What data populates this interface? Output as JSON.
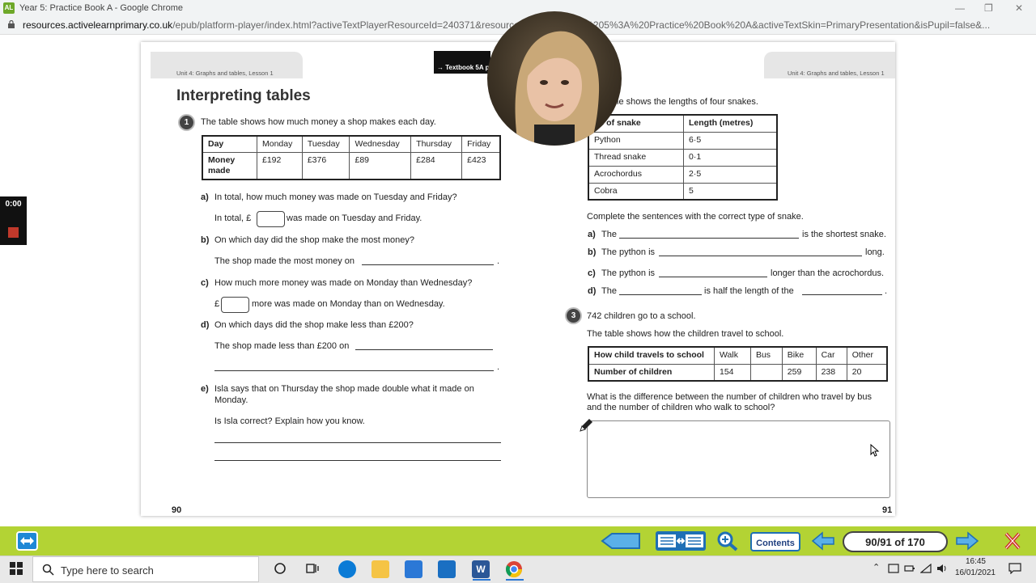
{
  "browser": {
    "window_title": "Year 5: Practice Book A - Google Chrome",
    "app_badge": "AL",
    "url_host": "resources.activelearnprimary.co.uk",
    "url_path": "/epub/platform-player/index.html?activeTextPlayerResourceId=240371&resourceId=...Title=Year%205%3A%20Practice%20Book%20A&activeTextSkin=PrimaryPresentation&isPupil=false&..."
  },
  "recorder": {
    "time": "0:00"
  },
  "left_page": {
    "unit_label": "Unit 4: Graphs and tables, Lesson 1",
    "title": "Interpreting tables",
    "q1": {
      "number": "1",
      "intro": "The table shows how much money a shop makes each day.",
      "table_header": [
        "Day",
        "Monday",
        "Tuesday",
        "Wednesday",
        "Thursday",
        "Friday"
      ],
      "row_label": "Money made",
      "row_values": [
        "£192",
        "£376",
        "£89",
        "£284",
        "£423"
      ],
      "a_label": "a)",
      "a_q": "In total, how much money was made on Tuesday and Friday?",
      "a_pre": "In total, £",
      "a_post": "was made on Tuesday and Friday.",
      "b_label": "b)",
      "b_q": "On which day did the shop make the most money?",
      "b_ans": "The shop made the most money on",
      "c_label": "c)",
      "c_q": "How much more money was made on Monday than Wednesday?",
      "c_pre": "£",
      "c_post": "more was made on Monday than on Wednesday.",
      "d_label": "d)",
      "d_q": "On which days did the shop make less than £200?",
      "d_ans": "The shop made less than £200 on",
      "e_label": "e)",
      "e_q1": "Isla says that on Thursday the shop made double what it made on",
      "e_q2": "Monday.",
      "e_sub": "Is Isla correct? Explain how you know."
    },
    "page_number": "90",
    "textbook_tab": "→ Textbook 5A p"
  },
  "right_page": {
    "unit_label": "Unit 4: Graphs and tables, Lesson 1",
    "q2": {
      "intro_visible": "le shows the lengths of four snakes.",
      "header": [
        "pe of snake",
        "Length (metres)"
      ],
      "rows": [
        [
          "Python",
          "6·5"
        ],
        [
          "Thread snake",
          "0·1"
        ],
        [
          "Acrochordus",
          "2·5"
        ],
        [
          "Cobra",
          "5"
        ]
      ],
      "instruction": "Complete the sentences with the correct type of snake.",
      "a_label": "a)",
      "a_pre": "The",
      "a_post": "is the shortest snake.",
      "b_label": "b)",
      "b_pre": "The python is",
      "b_post": "long.",
      "c_label": "c)",
      "c_pre": "The python is",
      "c_post": "longer than the acrochordus.",
      "d_label": "d)",
      "d_pre": "The",
      "d_mid": "is half the length of the",
      "d_post": "."
    },
    "q3": {
      "number": "3",
      "intro": "742 children go to a school.",
      "intro2": "The table shows how the children travel to school.",
      "header": [
        "How child travels to school",
        "Walk",
        "Bus",
        "Bike",
        "Car",
        "Other"
      ],
      "row_label": "Number of children",
      "row_values": [
        "154",
        "",
        "259",
        "238",
        "20"
      ],
      "question1": "What is the difference between the number of children who travel by bus",
      "question2": "and the number of children who walk to school?"
    },
    "page_number": "91"
  },
  "toolbar": {
    "contents_label": "Contents",
    "page_counter": "90/91 of 170"
  },
  "taskbar": {
    "search_placeholder": "Type here to search",
    "time": "16:45",
    "date": "16/01/2021"
  },
  "colors": {
    "accent_green": "#b3d334",
    "nav_blue": "#1f6fb5",
    "close_red": "#d0312d"
  }
}
